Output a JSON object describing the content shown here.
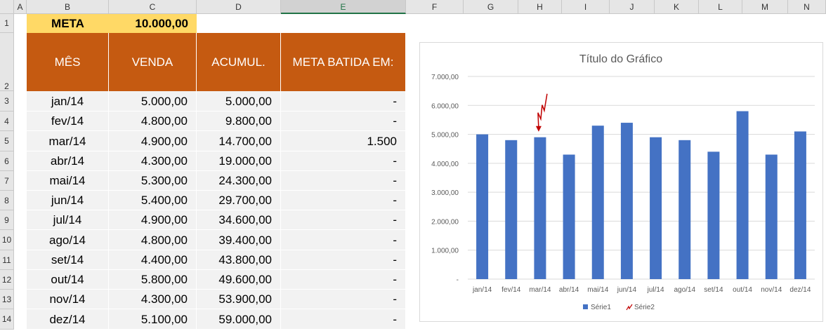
{
  "columns": [
    "A",
    "B",
    "C",
    "D",
    "E",
    "F",
    "G",
    "H",
    "I",
    "J",
    "K",
    "L",
    "M",
    "N"
  ],
  "rows": [
    "1",
    "2",
    "3",
    "4",
    "5",
    "6",
    "7",
    "8",
    "9",
    "10",
    "11",
    "12",
    "13",
    "14"
  ],
  "meta": {
    "label": "META",
    "value": "10.000,00"
  },
  "headers": {
    "mes": "MÊS",
    "venda": "VENDA",
    "acumul": "ACUMUL.",
    "meta_batida": "META BATIDA EM:"
  },
  "table": [
    {
      "mes": "jan/14",
      "venda": "5.000,00",
      "acumul": "5.000,00",
      "meta": "-"
    },
    {
      "mes": "fev/14",
      "venda": "4.800,00",
      "acumul": "9.800,00",
      "meta": "-"
    },
    {
      "mes": "mar/14",
      "venda": "4.900,00",
      "acumul": "14.700,00",
      "meta": "1.500"
    },
    {
      "mes": "abr/14",
      "venda": "4.300,00",
      "acumul": "19.000,00",
      "meta": "-"
    },
    {
      "mes": "mai/14",
      "venda": "5.300,00",
      "acumul": "24.300,00",
      "meta": "-"
    },
    {
      "mes": "jun/14",
      "venda": "5.400,00",
      "acumul": "29.700,00",
      "meta": "-"
    },
    {
      "mes": "jul/14",
      "venda": "4.900,00",
      "acumul": "34.600,00",
      "meta": "-"
    },
    {
      "mes": "ago/14",
      "venda": "4.800,00",
      "acumul": "39.400,00",
      "meta": "-"
    },
    {
      "mes": "set/14",
      "venda": "4.400,00",
      "acumul": "43.800,00",
      "meta": "-"
    },
    {
      "mes": "out/14",
      "venda": "5.800,00",
      "acumul": "49.600,00",
      "meta": "-"
    },
    {
      "mes": "nov/14",
      "venda": "4.300,00",
      "acumul": "53.900,00",
      "meta": "-"
    },
    {
      "mes": "dez/14",
      "venda": "5.100,00",
      "acumul": "59.000,00",
      "meta": "-"
    }
  ],
  "colors": {
    "header_fill": "#C55A11",
    "meta_fill": "#FFD966",
    "row_fill": "#F2F2F2",
    "bar": "#4472C4",
    "annotation": "#C00000"
  },
  "chart_data": {
    "type": "bar",
    "title": "Título do Gráfico",
    "categories": [
      "jan/14",
      "fev/14",
      "mar/14",
      "abr/14",
      "mai/14",
      "jun/14",
      "jul/14",
      "ago/14",
      "set/14",
      "out/14",
      "nov/14",
      "dez/14"
    ],
    "series": [
      {
        "name": "Série1",
        "values": [
          5000,
          4800,
          4900,
          4300,
          5300,
          5400,
          4900,
          4800,
          4400,
          5800,
          4300,
          5100
        ]
      },
      {
        "name": "Série2",
        "marker_category": "mar/14",
        "marker_value": 4900
      }
    ],
    "ylim": [
      0,
      7000
    ],
    "yticks": [
      "-",
      "1.000,00",
      "2.000,00",
      "3.000,00",
      "4.000,00",
      "5.000,00",
      "6.000,00",
      "7.000,00"
    ],
    "grid": true,
    "legend": "bottom"
  }
}
